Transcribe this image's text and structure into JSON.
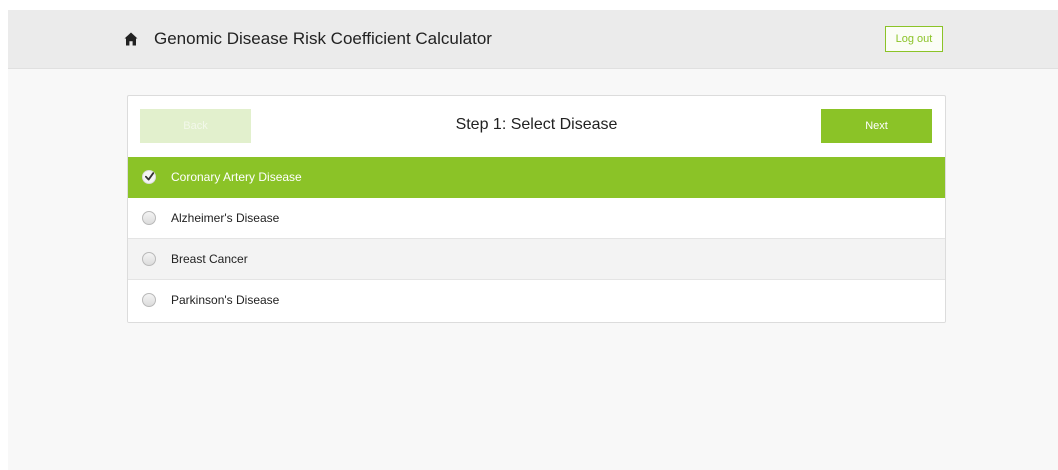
{
  "header": {
    "title": "Genomic Disease Risk Coefficient Calculator",
    "home_icon": "home-icon",
    "logout_label": "Log out"
  },
  "wizard": {
    "step_title": "Step 1: Select Disease",
    "back_label": "Back",
    "next_label": "Next",
    "back_enabled": false
  },
  "diseases": [
    {
      "label": "Coronary Artery Disease",
      "selected": true
    },
    {
      "label": "Alzheimer's Disease",
      "selected": false
    },
    {
      "label": "Breast Cancer",
      "selected": false
    },
    {
      "label": "Parkinson's Disease",
      "selected": false
    }
  ],
  "colors": {
    "accent": "#8bc327",
    "accent_disabled": "#e2f0cd",
    "header_bg": "#ebebeb",
    "page_bg": "#f8f8f8"
  }
}
